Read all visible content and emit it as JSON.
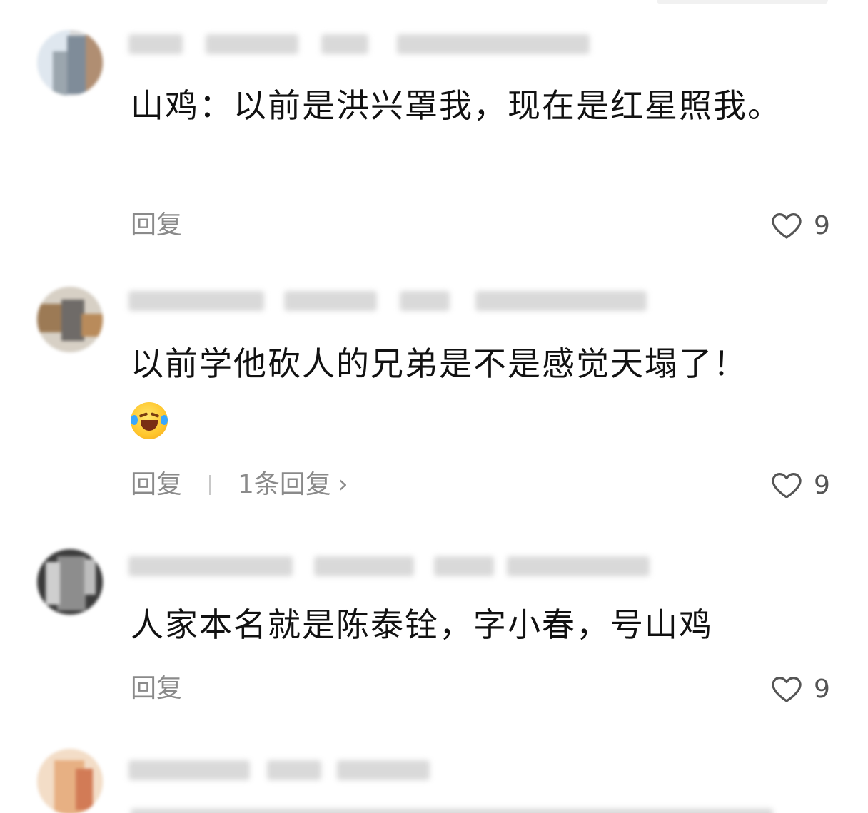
{
  "comments": [
    {
      "text": "山鸡：以前是洪兴罩我，现在是红星照我。",
      "reply_label": "回复",
      "likes": "9"
    },
    {
      "text": "以前学他砍人的兄弟是不是感觉天塌了！",
      "emoji": "laughing-crying-emoji",
      "reply_label": "回复",
      "replies_link": "1条回复",
      "likes": "9"
    },
    {
      "text": "人家本名就是陈泰铨，字小春，号山鸡",
      "reply_label": "回复",
      "likes": "9"
    }
  ],
  "icons": {
    "like": "heart-outline-icon",
    "more_replies": "chevron-right-icon"
  },
  "colors": {
    "text": "#111111",
    "secondary": "#8a8a8a",
    "heart": "#555555"
  }
}
